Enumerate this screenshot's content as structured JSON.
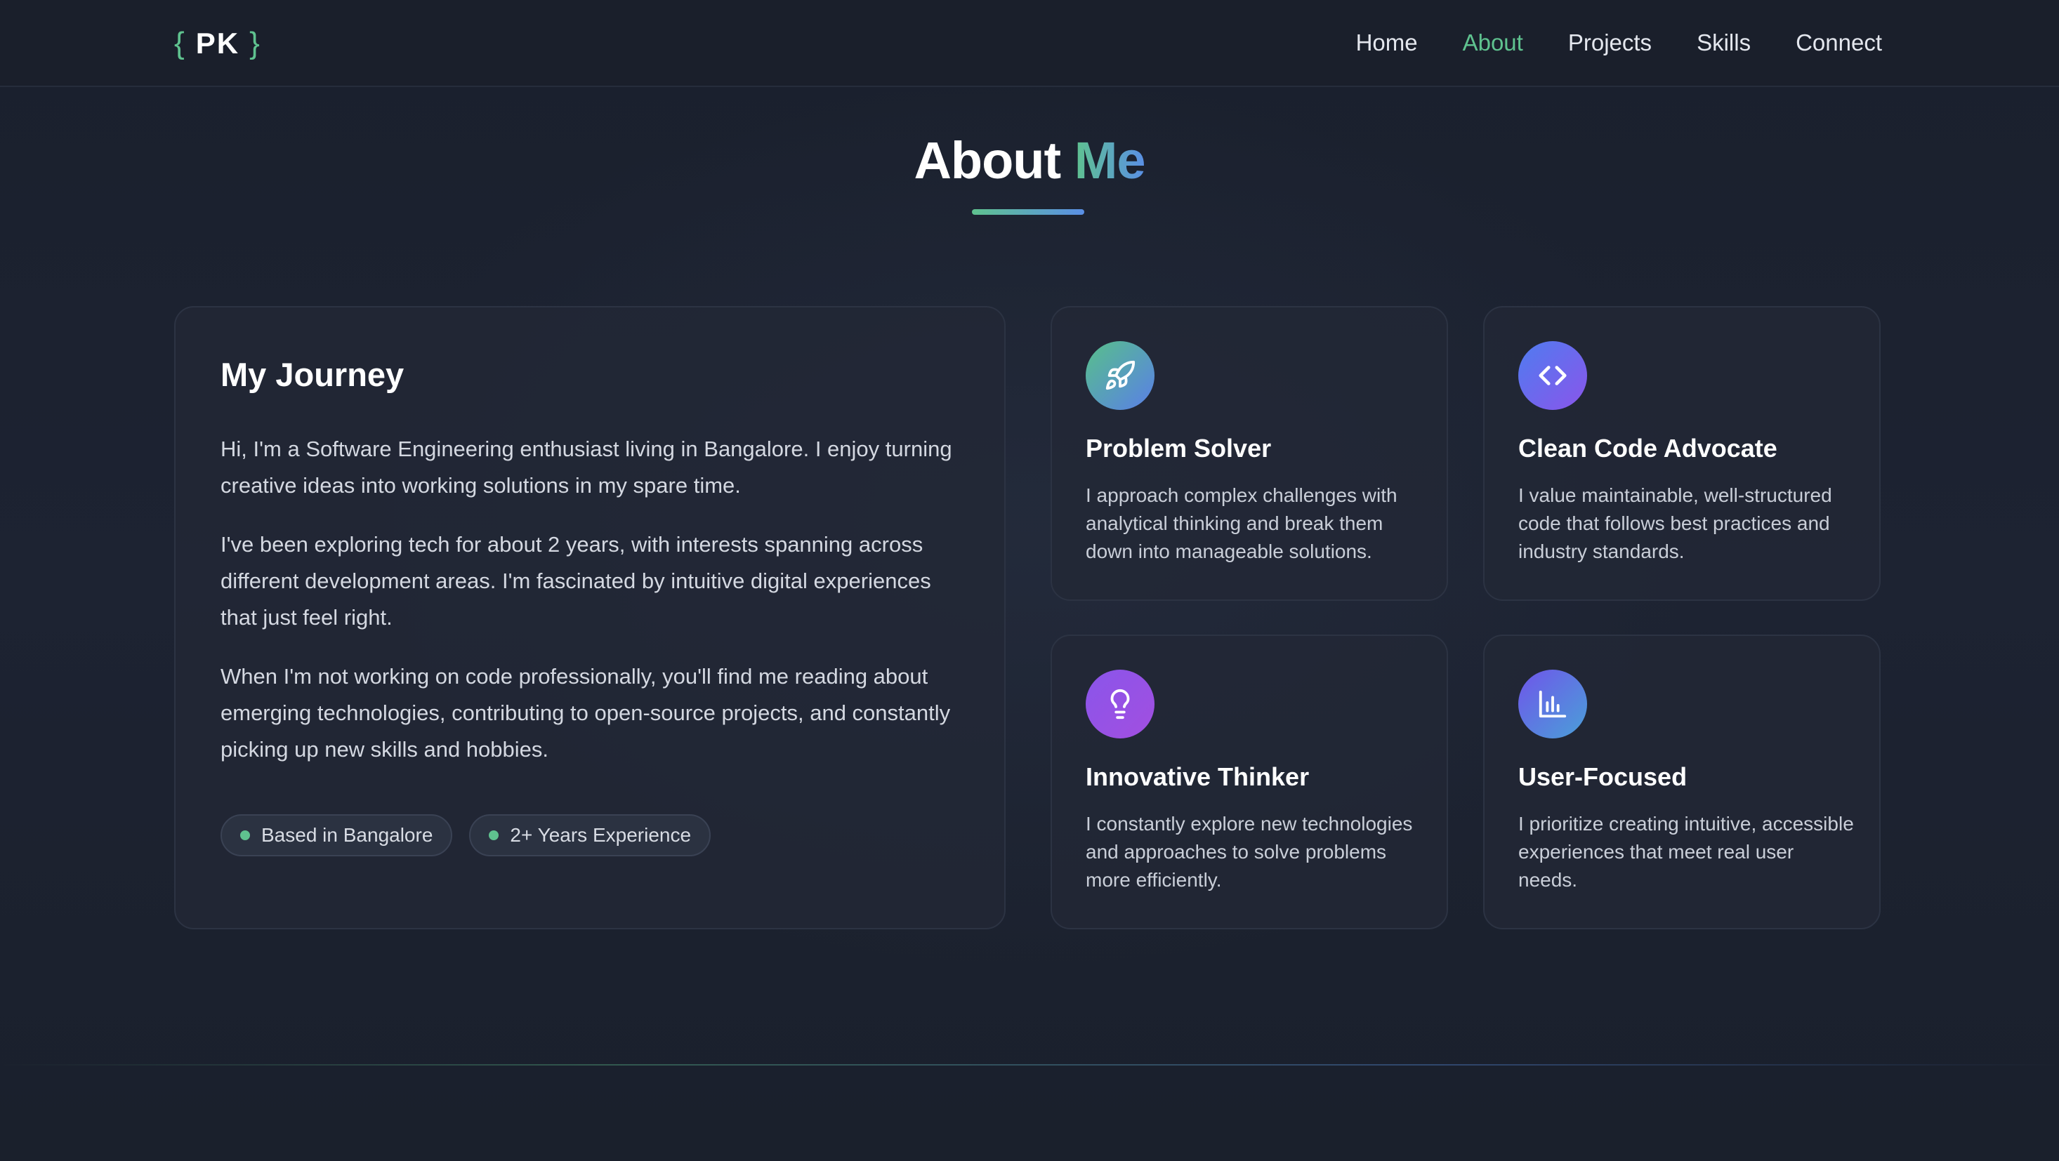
{
  "nav": {
    "logo": {
      "open_brace": "{",
      "initials": "PK",
      "close_brace": "}"
    },
    "links": [
      {
        "label": "Home",
        "active": false
      },
      {
        "label": "About",
        "active": true
      },
      {
        "label": "Projects",
        "active": false
      },
      {
        "label": "Skills",
        "active": false
      },
      {
        "label": "Connect",
        "active": false
      }
    ]
  },
  "section": {
    "title_part1": "About",
    "title_part2": "Me"
  },
  "journey": {
    "heading": "My Journey",
    "paragraphs": [
      "Hi, I'm a Software Engineering enthusiast living in Bangalore. I enjoy turning creative ideas into working solutions in my spare time.",
      "I've been exploring tech for about 2 years, with interests spanning across different development areas. I'm fascinated by intuitive digital experiences that just feel right.",
      "When I'm not working on code professionally, you'll find me reading about emerging technologies, contributing to open-source projects, and constantly picking up new skills and hobbies."
    ],
    "badges": [
      "Based in Bangalore",
      "2+ Years Experience"
    ]
  },
  "features": [
    {
      "icon": "rocket-icon",
      "title": "Problem Solver",
      "description": "I approach complex challenges with analytical thinking and break them down into manageable solutions."
    },
    {
      "icon": "code-icon",
      "title": "Clean Code Advocate",
      "description": "I value maintainable, well-structured code that follows best practices and industry standards."
    },
    {
      "icon": "lightbulb-icon",
      "title": "Innovative Thinker",
      "description": "I constantly explore new technologies and approaches to solve problems more efficiently."
    },
    {
      "icon": "bar-chart-icon",
      "title": "User-Focused",
      "description": "I prioritize creating intuitive, accessible experiences that meet real user needs."
    }
  ],
  "colors": {
    "accent_green": "#5fc28f",
    "accent_blue": "#5a8fe6",
    "accent_purple": "#8a55ea",
    "background": "#1b2130"
  }
}
